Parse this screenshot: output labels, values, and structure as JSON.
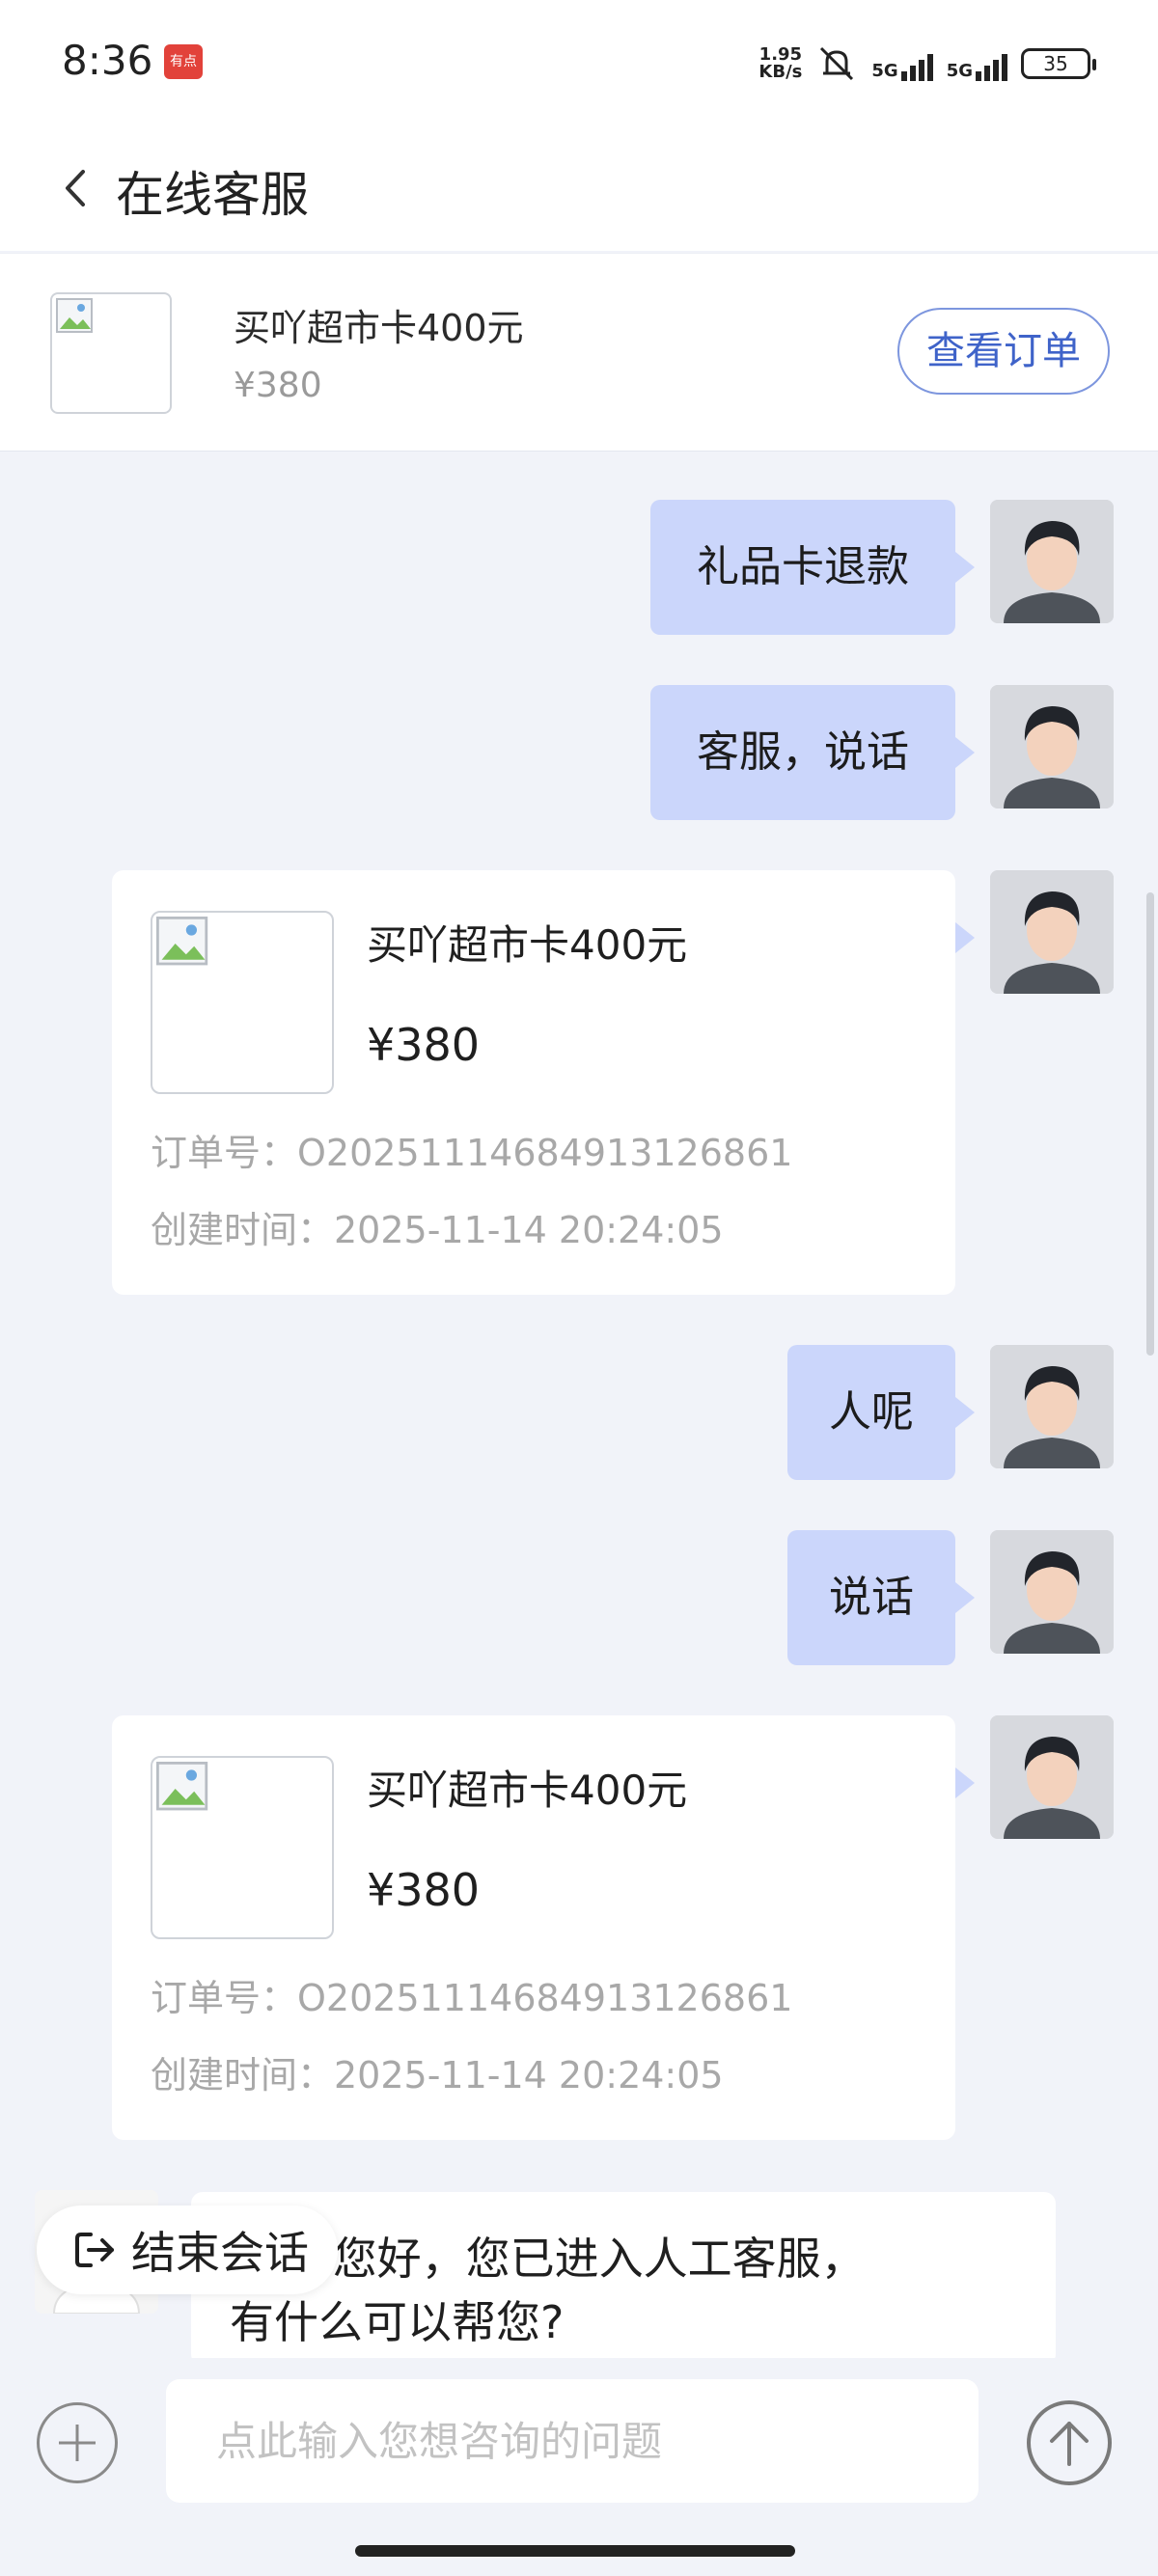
{
  "status_bar": {
    "time": "8:36",
    "app_badge": "有点",
    "net_speed_value": "1.95",
    "net_speed_unit": "KB/s",
    "signal1": "5G",
    "signal2": "5G",
    "battery": "35"
  },
  "header": {
    "title": "在线客服"
  },
  "order_card": {
    "name": "买吖超市卡400元",
    "price": "¥380",
    "view_button": "查看订单"
  },
  "messages": {
    "m1": "礼品卡退款",
    "m2": "客服，说话",
    "product1": {
      "name": "买吖超市卡400元",
      "price": "¥380",
      "order_no": "订单号：O20251114684913126861",
      "created": "创建时间：2025-11-14 20:24:05"
    },
    "m3": "人呢",
    "m4": "说话",
    "product2": {
      "name": "买吖超市卡400元",
      "price": "¥380",
      "order_no": "订单号：O20251114684913126861",
      "created": "创建时间：2025-11-14 20:24:05"
    },
    "agent_line1": "主，  您好，您已进入人工客服，",
    "agent_line2": "有什么可以帮您?"
  },
  "end_session": {
    "label": "结束会话"
  },
  "input": {
    "placeholder": "点此输入您想咨询的问题",
    "value": ""
  },
  "colors": {
    "user_bubble": "#cbd6fb",
    "accent": "#3f63c9",
    "background": "#f1f3f9"
  }
}
